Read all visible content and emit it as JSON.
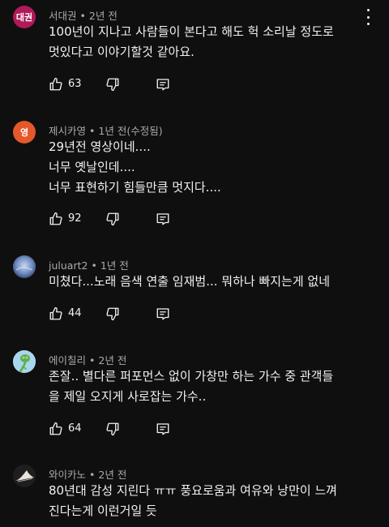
{
  "comments": [
    {
      "author": "서대권",
      "time": "2년 전",
      "avatar": {
        "text": "대권",
        "color": "#b0195a"
      },
      "lines": [
        "100년이 지나고 사람들이 본다고 해도 헉 소리날 정도로",
        "멋있다고 이야기할것 같아요."
      ],
      "likes": "63"
    },
    {
      "author": "제시카영",
      "time": "1년 전(수정됨)",
      "avatar": {
        "text": "영",
        "color": "#e5582c"
      },
      "lines": [
        "29년전 영상이네....",
        "너무 옛날인데....",
        "너무 표현하기 힘들만큼 멋지다...."
      ],
      "likes": "92"
    },
    {
      "author": "juluart2",
      "time": "1년 전",
      "avatar": {
        "text": "",
        "color": "#4c6a9c"
      },
      "lines": [
        "미쳤다...노래 음색 연출  임재범... 뭐하나 빠지는게 없네"
      ],
      "likes": "44"
    },
    {
      "author": "에이칠리",
      "time": "2년 전",
      "avatar": {
        "text": "",
        "color": "#9bcde6"
      },
      "lines": [
        "존잘.. 별다른 퍼포먼스 없이 가창만 하는 가수 중 관객들",
        "을 제일 오지게 사로잡는 가수.."
      ],
      "likes": "64"
    },
    {
      "author": "와이카노",
      "time": "2년 전",
      "avatar": {
        "text": "",
        "color": "#2a2a2a"
      },
      "lines": [
        "80년대 감성 지린다 ㅠㅠ 풍요로움과 여유와 낭만이 느껴",
        "진다는게 이런거일 듯"
      ],
      "likes": ""
    }
  ],
  "icons": {
    "like": "thumbs-up-icon",
    "dislike": "thumbs-down-icon",
    "reply": "reply-icon",
    "more": "more-vertical-icon"
  },
  "colors": {
    "background": "#0f0f0f",
    "text": "#f1f1f1",
    "meta": "#aaaaaa"
  }
}
